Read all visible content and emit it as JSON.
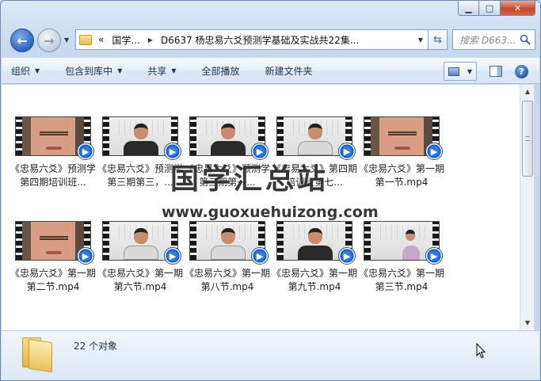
{
  "window": {
    "minimize": "▁",
    "maximize": "□",
    "close": "✕"
  },
  "nav": {
    "back": "←",
    "forward": "→",
    "breadcrumbs": [
      "«",
      "国学...",
      "D6637 杨忠易六爻预测学基础及实战共22集..."
    ],
    "search_placeholder": "搜索 D663..."
  },
  "toolbar": {
    "items": [
      {
        "label": "组织",
        "dropdown": true
      },
      {
        "label": "包含到库中",
        "dropdown": true
      },
      {
        "label": "共享",
        "dropdown": true
      },
      {
        "label": "全部播放",
        "dropdown": false
      },
      {
        "label": "新建文件夹",
        "dropdown": false
      }
    ],
    "help": "?"
  },
  "files": [
    {
      "label": "《忠易六爻》预测学第四期培训班...",
      "thumb": "face"
    },
    {
      "label": "《忠易六爻》预测学第三期第三，...",
      "thumb": "person"
    },
    {
      "label": "《忠易六爻》预测学第三期第一...",
      "thumb": "person"
    },
    {
      "label": "《忠易六爻》第四期培训班第七...",
      "thumb": "person-light"
    },
    {
      "label": "《忠易六爻》第一期第一节.mp4",
      "thumb": "face"
    },
    {
      "label": "《忠易六爻》第一期第二节.mp4",
      "thumb": "face"
    },
    {
      "label": "《忠易六爻》第一期第六节.mp4",
      "thumb": "person-light"
    },
    {
      "label": "《忠易六爻》第一期第八节.mp4",
      "thumb": "person-light"
    },
    {
      "label": "《忠易六爻》第一期第九节.mp4",
      "thumb": "person"
    },
    {
      "label": "《忠易六爻》第一期第三节.mp4",
      "thumb": "person-side"
    }
  ],
  "watermark": {
    "title": "国学汇总站",
    "url": "www.guoxuehuizong.com"
  },
  "status": {
    "count_text": "22 个对象"
  }
}
